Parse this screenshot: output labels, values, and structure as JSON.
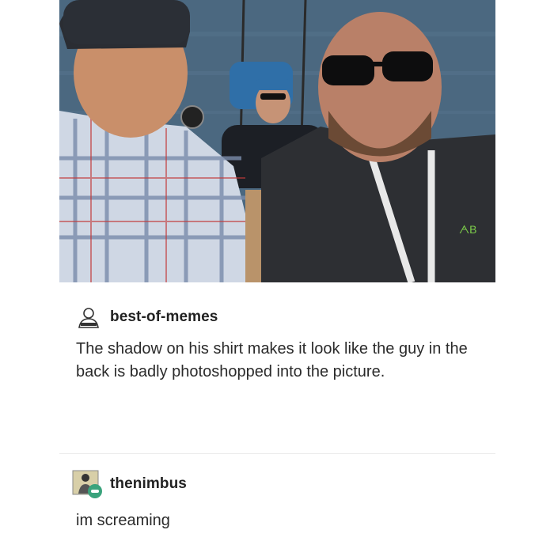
{
  "post1": {
    "username": "best-of-memes",
    "text": "The shadow on his shirt makes it look like the guy in the back is badly photoshopped into the picture."
  },
  "post2": {
    "username": "thenimbus",
    "text": "im screaming"
  },
  "photo": {
    "shirt_logo": "ᗅB"
  },
  "colors": {
    "sea": "#46647c",
    "text": "#2b2b2b"
  }
}
